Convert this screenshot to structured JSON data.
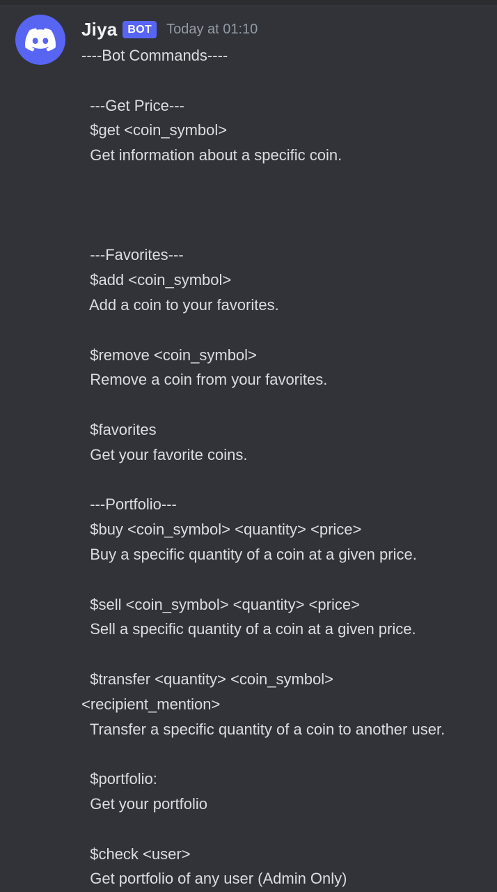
{
  "message": {
    "author": "Jiya",
    "badge": "BOT",
    "timestamp": "Today at 01:10",
    "avatar_icon": "discord-logo-icon",
    "colors": {
      "background": "#313338",
      "avatar": "#5865f2",
      "badge": "#5865f2",
      "text": "#dbdee1",
      "timestamp": "#949ba4"
    },
    "lines": [
      "----Bot Commands----",
      "",
      "  ---Get Price---",
      "  $get <coin_symbol>",
      "  Get information about a specific coin.",
      "",
      "",
      "",
      "  ---Favorites---",
      "  $add <coin_symbol>",
      "  Add a coin to your favorites.",
      "",
      "  $remove <coin_symbol>",
      "  Remove a coin from your favorites.",
      "",
      "  $favorites",
      "  Get your favorite coins.",
      "",
      "  ---Portfolio---",
      "  $buy <coin_symbol> <quantity> <price>",
      "  Buy a specific quantity of a coin at a given price.",
      "",
      "  $sell <coin_symbol> <quantity> <price>",
      "  Sell a specific quantity of a coin at a given price.",
      "",
      "  $transfer <quantity> <coin_symbol>",
      "<recipient_mention>",
      "  Transfer a specific quantity of a coin to another user.",
      "",
      "  $portfolio:",
      "  Get your portfolio",
      "",
      "  $check <user>",
      "  Get portfolio of any user (Admin Only)"
    ]
  }
}
